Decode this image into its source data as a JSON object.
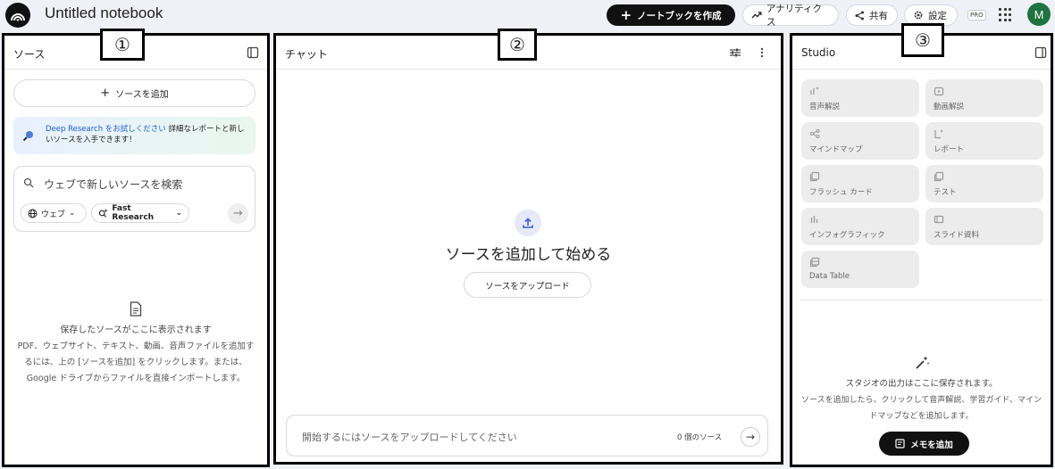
{
  "app": {
    "notebook_title": "Untitled notebook",
    "create_notebook": "ノートブックを作成",
    "analytics": "アナリティクス",
    "share": "共有",
    "settings": "設定",
    "pro_badge": "PRO",
    "avatar_initial": "M"
  },
  "markers": {
    "one": "①",
    "two": "②",
    "three": "③"
  },
  "sources": {
    "title": "ソース",
    "add_button": "ソースを追加",
    "deep_research_link": "Deep Research をお試しください",
    "deep_research_text": " 詳細なレポートと新しいソースを入手できます！",
    "search_placeholder": "ウェブで新しいソースを検索",
    "chip_web": "ウェブ",
    "chip_fast": "Fast Research",
    "empty_title": "保存したソースがここに表示されます",
    "empty_desc": "PDF、ウェブサイト、テキスト、動画、音声ファイルを追加するには、上の [ソースを追加] をクリックします。または、Google ドライブからファイルを直接インポートします。"
  },
  "chat": {
    "title": "チャット",
    "headline": "ソースを追加して始める",
    "upload_button": "ソースをアップロード",
    "input_placeholder": "開始するにはソースをアップロードしてください",
    "source_count": "0 個のソース"
  },
  "studio": {
    "title": "Studio",
    "tiles": [
      {
        "label": "音声解説",
        "icon": "audio-sparkle-icon"
      },
      {
        "label": "動画解説",
        "icon": "video-icon"
      },
      {
        "label": "マインドマップ",
        "icon": "mindmap-icon"
      },
      {
        "label": "レポート",
        "icon": "report-icon"
      },
      {
        "label": "フラッシュ カード",
        "icon": "flashcard-icon"
      },
      {
        "label": "テスト",
        "icon": "quiz-icon"
      },
      {
        "label": "インフォグラフィック",
        "icon": "infographic-icon"
      },
      {
        "label": "スライド資料",
        "icon": "slides-icon"
      },
      {
        "label": "Data Table",
        "icon": "table-icon"
      }
    ],
    "empty_title": "スタジオの出力はここに保存されます。",
    "empty_desc": "ソースを追加したら、クリックして音声解説、学習ガイド、マインドマップなどを追加します。",
    "add_note": "メモを追加"
  }
}
